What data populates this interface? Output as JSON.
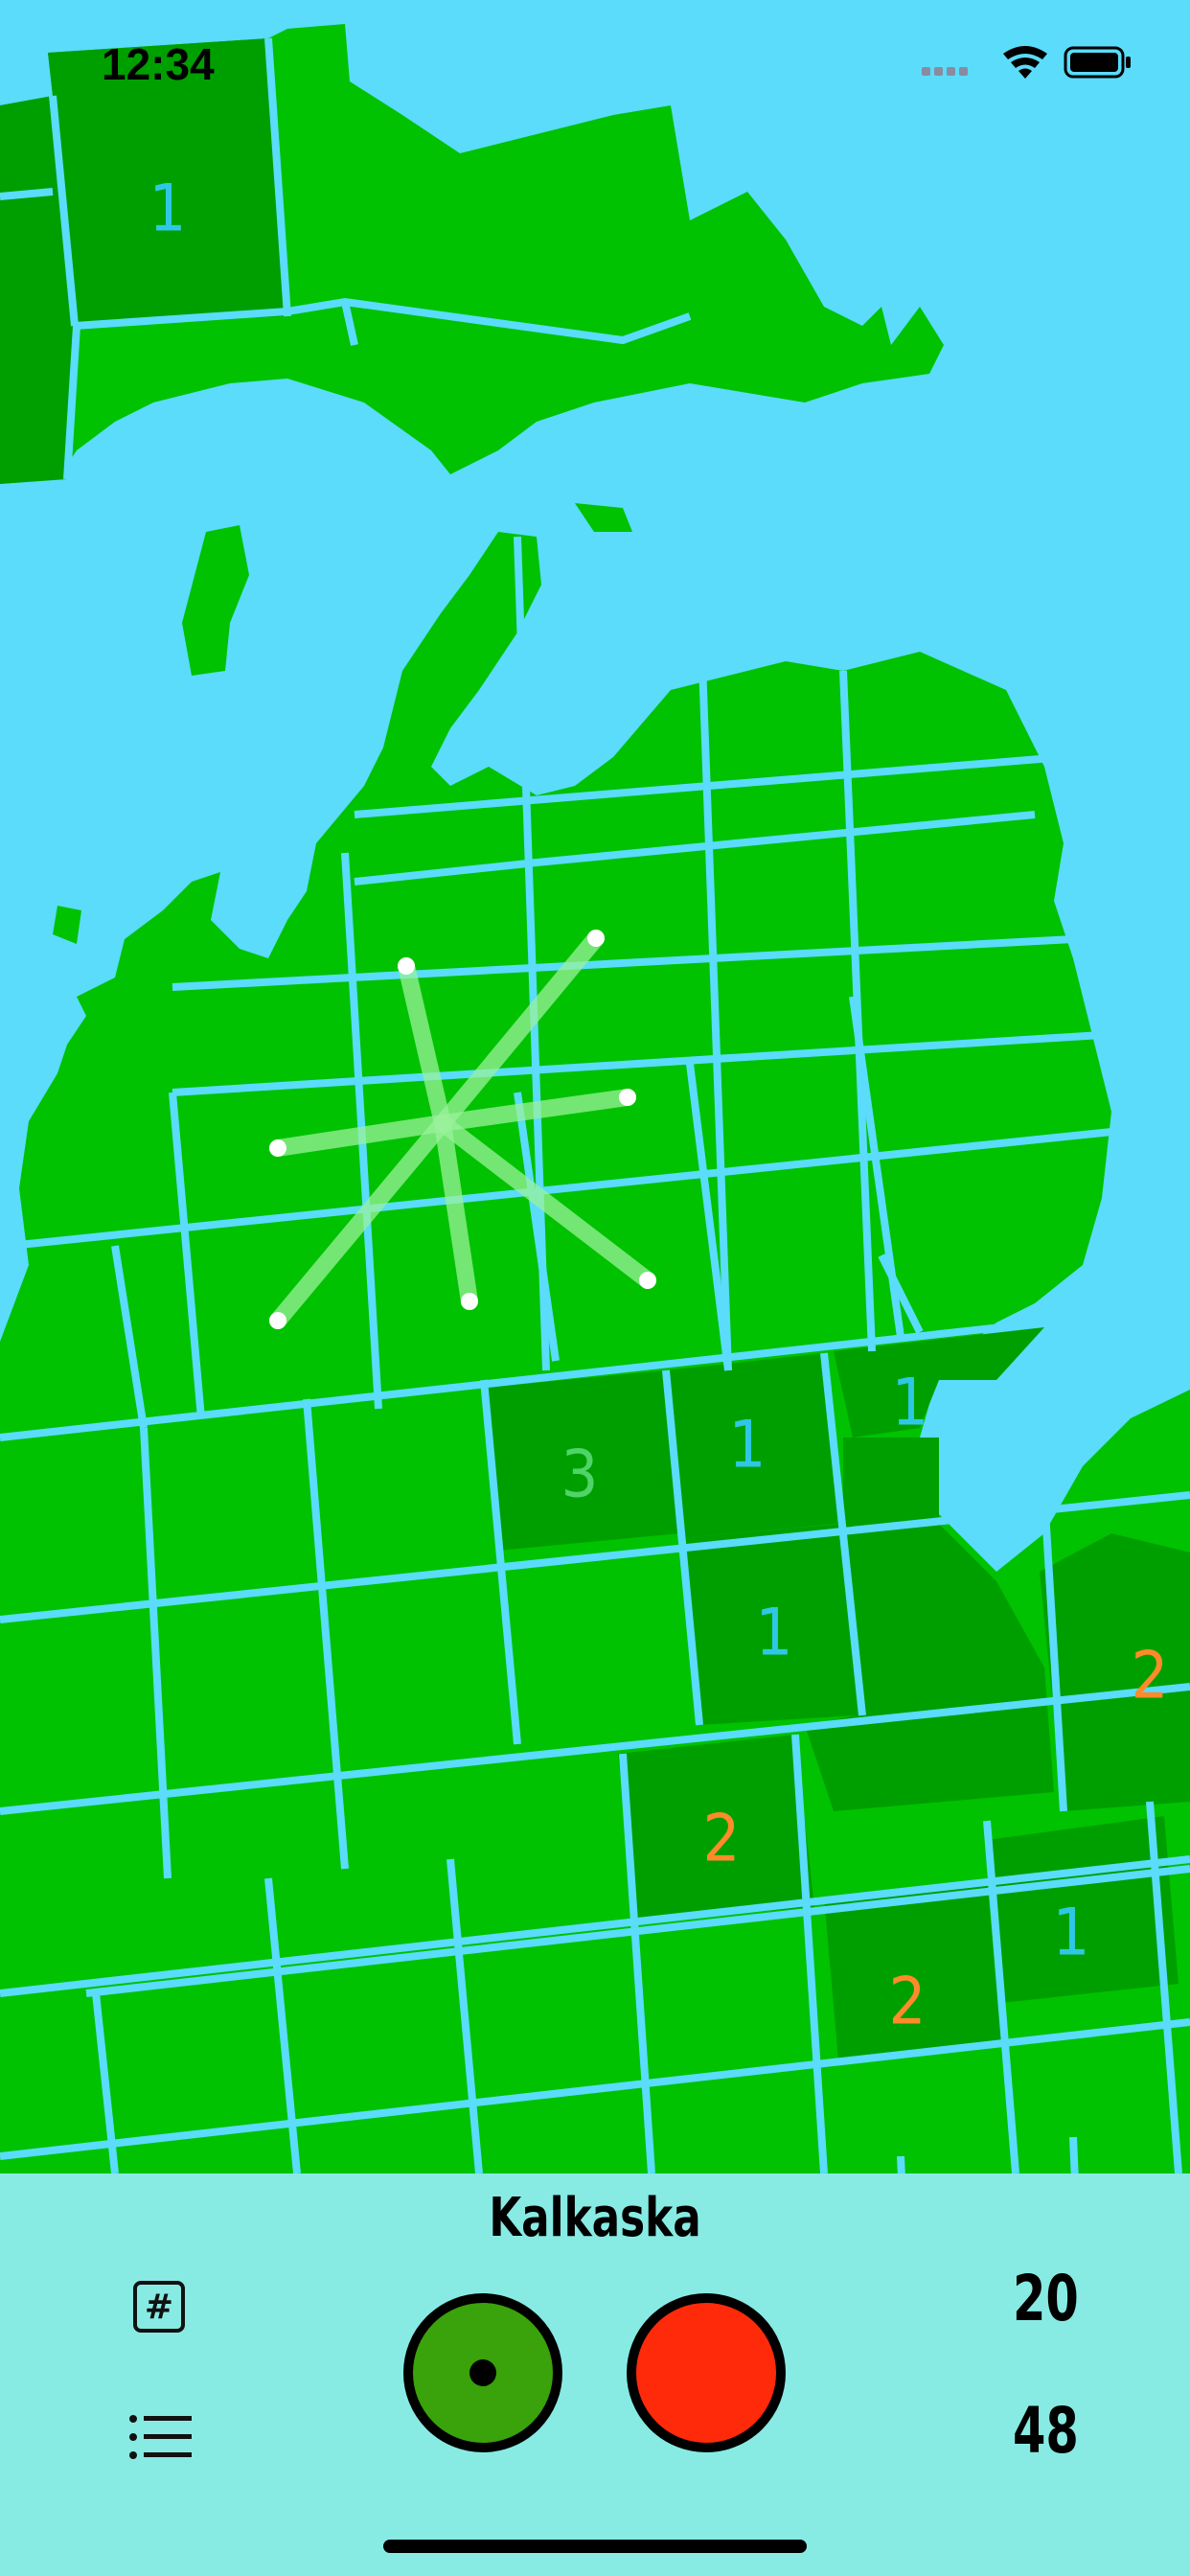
{
  "status_bar": {
    "time": "12:34",
    "icons": [
      "cellular-signal-icon",
      "wifi-icon",
      "battery-icon"
    ]
  },
  "map": {
    "region": "Michigan counties",
    "colors": {
      "water": "#5adcfa",
      "land": "#00c200",
      "revealed": "#009f00",
      "border": "#5adcfa",
      "number_1": "#2ec8e6",
      "number_2": "#ff8a2a",
      "number_3": "#4fd468",
      "selector_lines": "#8af08a"
    },
    "county_numbers": [
      {
        "value": "1",
        "color": "#2ec8e6"
      },
      {
        "value": "3",
        "color": "#4fd468"
      },
      {
        "value": "1",
        "color": "#2ec8e6"
      },
      {
        "value": "1",
        "color": "#2ec8e6"
      },
      {
        "value": "1",
        "color": "#2ec8e6"
      },
      {
        "value": "2",
        "color": "#ff8a2a"
      },
      {
        "value": "2",
        "color": "#ff8a2a"
      },
      {
        "value": "2",
        "color": "#ff8a2a"
      },
      {
        "value": "1",
        "color": "#2ec8e6"
      }
    ]
  },
  "panel": {
    "county_name": "Kalkaska",
    "hash_label": "#",
    "score_top": "20",
    "score_bottom": "48",
    "colors": {
      "reveal_button": "#3aa20a",
      "flag_button": "#ff2a0a"
    }
  }
}
